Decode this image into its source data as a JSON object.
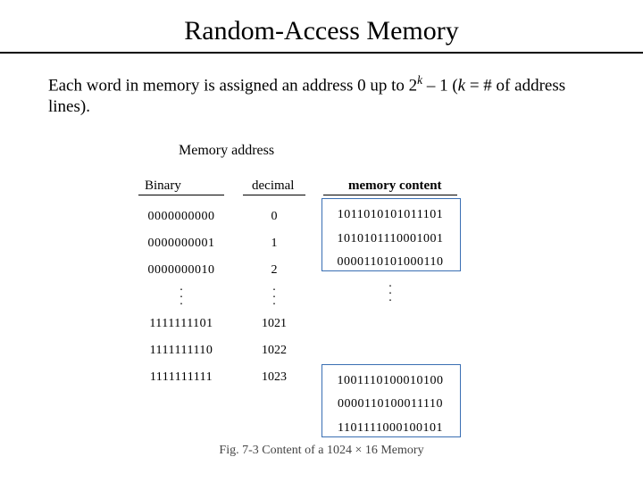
{
  "title": "Random-Access Memory",
  "body_pre": "Each word in memory is assigned an address 0 up to 2",
  "body_sup": "k",
  "body_mid": " – 1 (",
  "body_k": "k",
  "body_post": " = # of address lines).",
  "overlay_label": "memory content",
  "headers": {
    "memaddr": "Memory address",
    "binary": "Binary",
    "decimal": "decimal"
  },
  "rows_top": {
    "bin": [
      "0000000000",
      "0000000001",
      "0000000010"
    ],
    "dec": [
      "0",
      "1",
      "2"
    ],
    "con": [
      "1011010101011101",
      "1010101110001001",
      "0000110101000110"
    ]
  },
  "rows_bot": {
    "bin": [
      "1111111101",
      "1111111110",
      "1111111111"
    ],
    "dec": [
      "1021",
      "1022",
      "1023"
    ],
    "con": [
      "1001110100010100",
      "0000110100011110",
      "1101111000100101"
    ]
  },
  "figcap": "Fig. 7-3  Content of a 1024 × 16 Memory"
}
